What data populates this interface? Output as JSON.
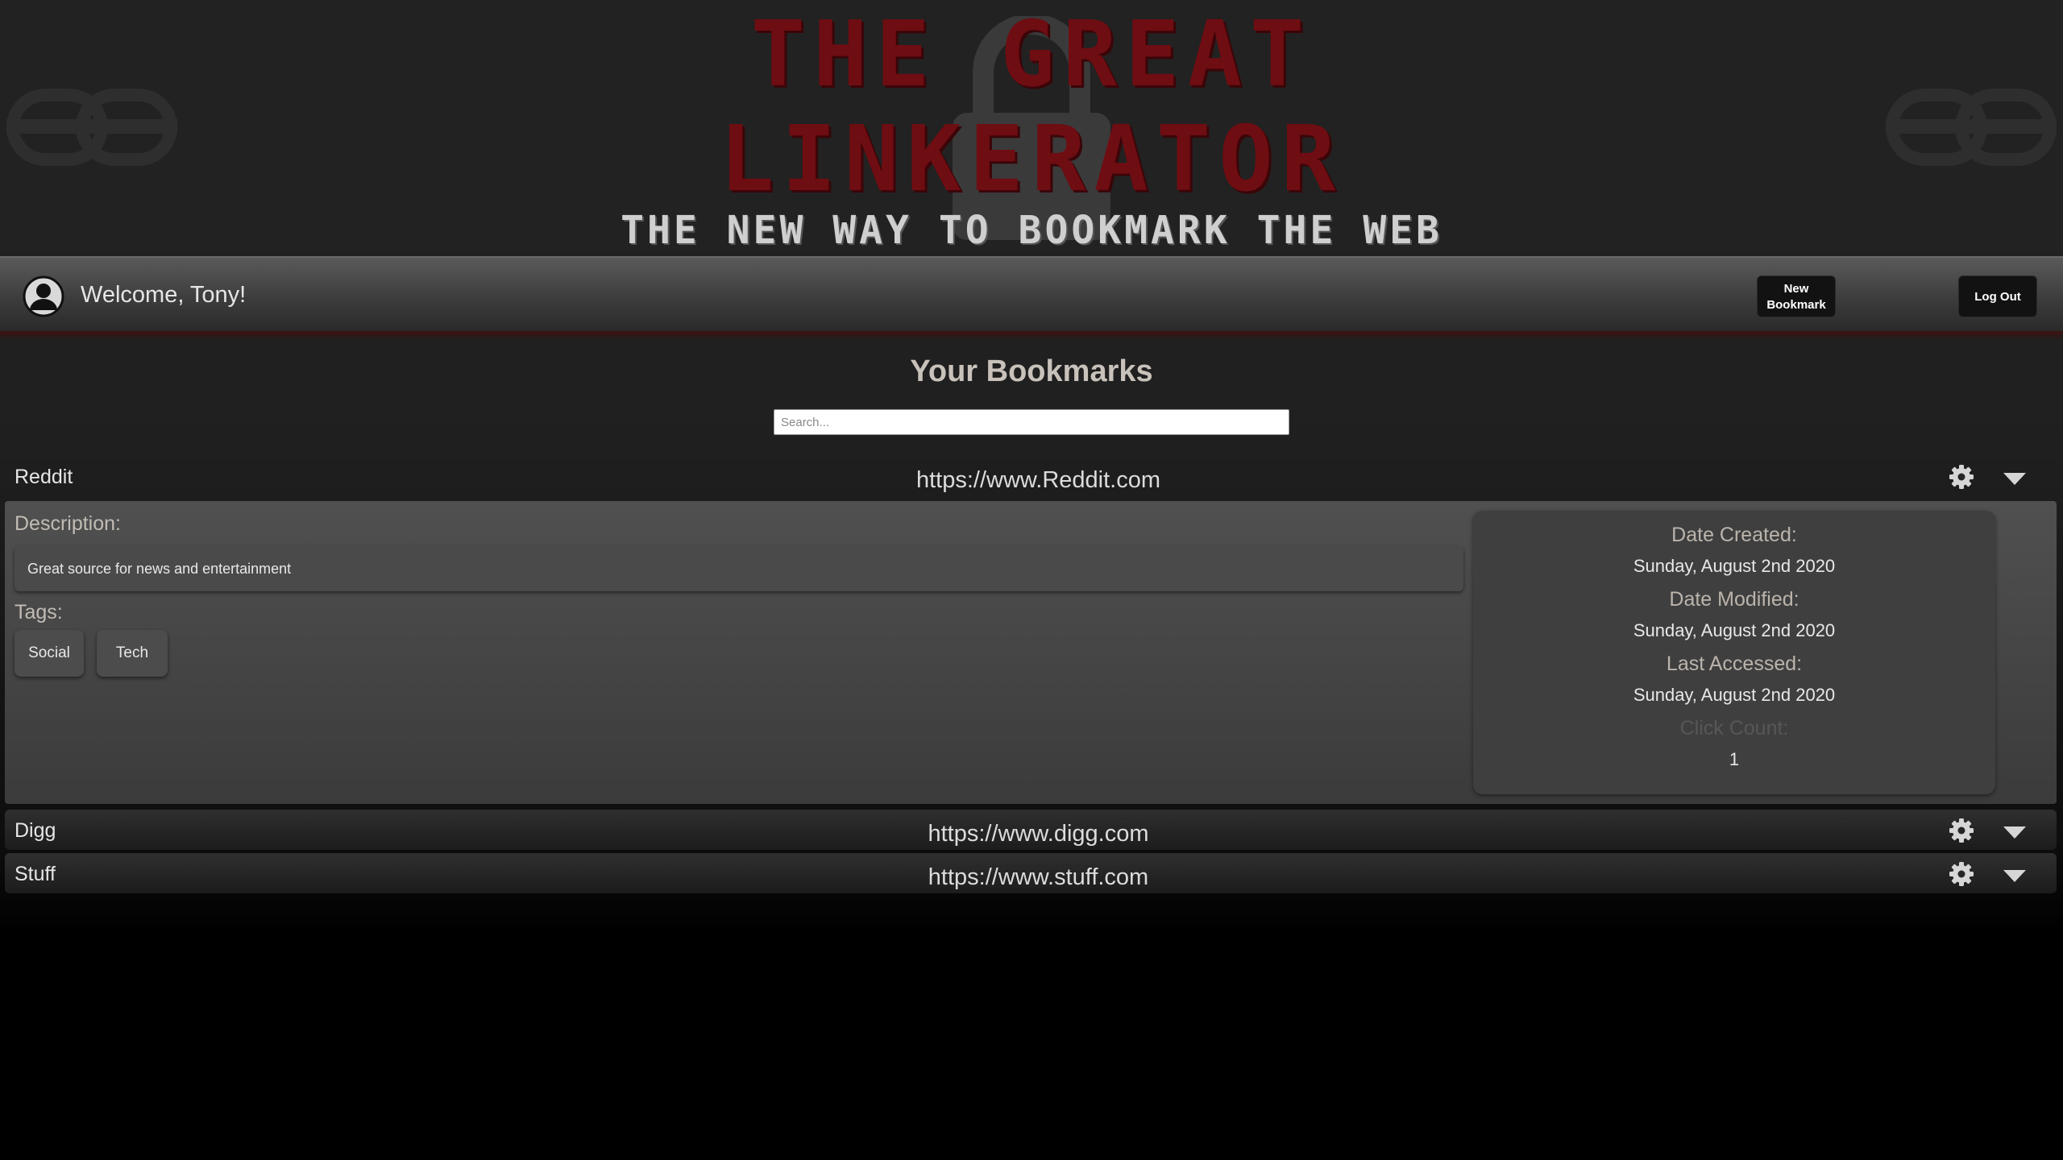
{
  "banner": {
    "title_line1": "THE GREAT",
    "title_line2": "LINKERATOR",
    "tagline": "THE NEW WAY TO BOOKMARK THE WEB"
  },
  "nav": {
    "welcome": "Welcome, Tony!",
    "new_bookmark_line1": "New",
    "new_bookmark_line2": "Bookmark",
    "logout": "Log Out"
  },
  "main": {
    "heading": "Your Bookmarks",
    "search_placeholder": "Search..."
  },
  "bookmarks": [
    {
      "name": "Reddit",
      "url": "https://www.Reddit.com",
      "expanded": true,
      "description_label": "Description:",
      "description": "Great source for news and entertainment",
      "tags_label": "Tags:",
      "tags": [
        "Social",
        "Tech"
      ],
      "meta": [
        {
          "label": "Date Created:",
          "value": "Sunday, August 2nd 2020"
        },
        {
          "label": "Date Modified:",
          "value": "Sunday, August 2nd 2020"
        },
        {
          "label": "Last Accessed:",
          "value": "Sunday, August 2nd 2020"
        },
        {
          "label": "Click Count:",
          "value": "1"
        }
      ]
    },
    {
      "name": "Digg",
      "url": "https://www.digg.com",
      "expanded": false
    },
    {
      "name": "Stuff",
      "url": "https://www.stuff.com",
      "expanded": false
    }
  ],
  "icons": {
    "settings": "gear-icon",
    "expand": "caret-down-icon",
    "user": "user-avatar-icon",
    "lock": "padlock-icon",
    "chain": "chain-link-icon"
  },
  "colors": {
    "title_red": "#6e0d12",
    "button_bg": "#121212",
    "heading": "#c8c2bb"
  }
}
